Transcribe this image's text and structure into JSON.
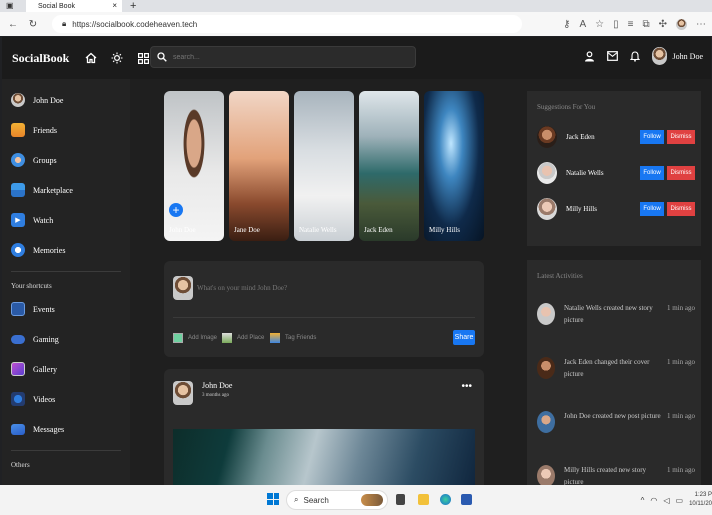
{
  "browser": {
    "tab_title": "Social Book",
    "url": "https://socialbook.codeheaven.tech"
  },
  "header": {
    "logo": "SocialBook",
    "search_placeholder": "search...",
    "user_name": "John Doe"
  },
  "sidebar": {
    "items": [
      {
        "label": "John Doe",
        "icon": "avatar"
      },
      {
        "label": "Friends",
        "icon": "friends-icon"
      },
      {
        "label": "Groups",
        "icon": "groups-icon"
      },
      {
        "label": "Marketplace",
        "icon": "marketplace-icon"
      },
      {
        "label": "Watch",
        "icon": "watch-icon"
      },
      {
        "label": "Memories",
        "icon": "memories-icon"
      }
    ],
    "shortcuts_title": "Your shortcuts",
    "shortcuts": [
      {
        "label": "Events",
        "icon": "events-icon"
      },
      {
        "label": "Gaming",
        "icon": "gaming-icon"
      },
      {
        "label": "Gallery",
        "icon": "gallery-icon"
      },
      {
        "label": "Videos",
        "icon": "videos-icon"
      },
      {
        "label": "Messages",
        "icon": "messages-icon"
      }
    ],
    "others_title": "Others"
  },
  "stories": [
    {
      "name": "John Doe",
      "add": true
    },
    {
      "name": "Jane Doe"
    },
    {
      "name": "Natalie Wells"
    },
    {
      "name": "Jack Eden"
    },
    {
      "name": "Milly Hills"
    }
  ],
  "composer": {
    "placeholder": "What's on your mind John Doe?",
    "add_image": "Add Image",
    "add_place": "Add Place",
    "tag_friends": "Tag Friends",
    "share": "Share"
  },
  "post": {
    "author": "John Doe",
    "time": "3 months ago"
  },
  "suggestions": {
    "title": "Suggestions For You",
    "follow_label": "Follow",
    "dismiss_label": "Dismiss",
    "people": [
      {
        "name": "Jack Eden"
      },
      {
        "name": "Natalie Wells"
      },
      {
        "name": "Milly Hills"
      }
    ]
  },
  "activities": {
    "title": "Latest Activities",
    "items": [
      {
        "text": "Natalie Wells created new story picture",
        "time": "1 min ago"
      },
      {
        "text": "Jack Eden changed their cover picture",
        "time": "1 min ago"
      },
      {
        "text": "John Doe created new post picture",
        "time": "1 min ago"
      },
      {
        "text": "Milly Hills created new story picture",
        "time": "1 min ago"
      }
    ]
  },
  "taskbar": {
    "search": "Search",
    "time": "1:23 P",
    "date": "10/11/20"
  }
}
